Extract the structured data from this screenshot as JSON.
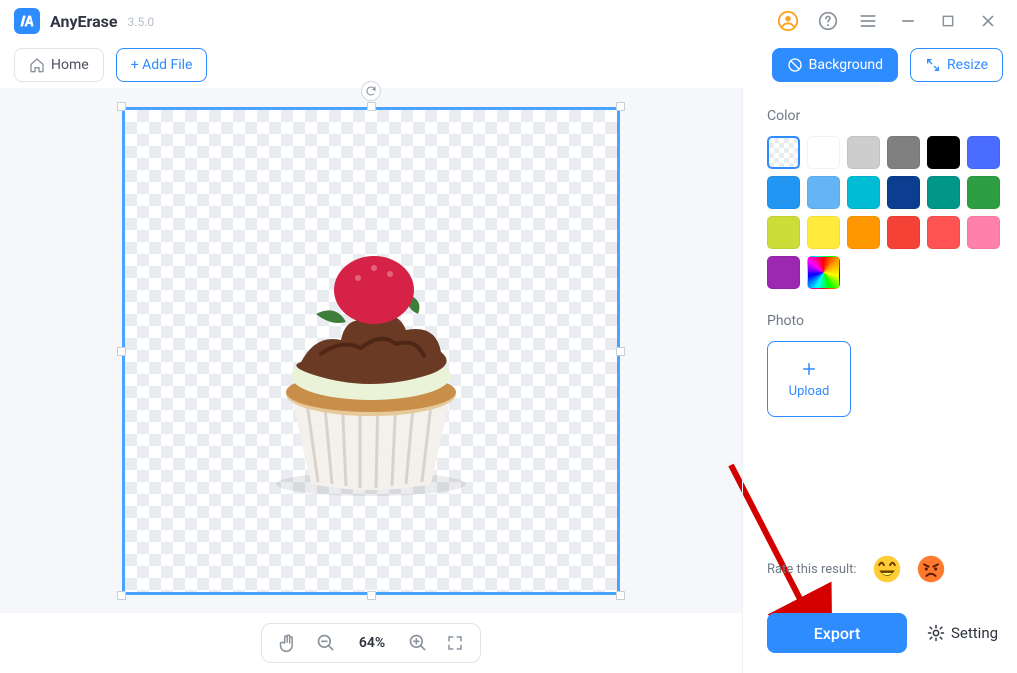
{
  "app": {
    "name": "AnyErase",
    "version": "3.5.0"
  },
  "toolbar": {
    "home": "Home",
    "add_file": "+ Add File",
    "background": "Background",
    "resize": "Resize"
  },
  "zoom": {
    "value": "64%"
  },
  "right_panel": {
    "color_title": "Color",
    "photo_title": "Photo",
    "upload_label": "Upload",
    "swatches": [
      "transparent",
      "#ffffff",
      "#cdcdcd",
      "#808080",
      "#000000",
      "#4a6cff",
      "#2196f3",
      "#64b5f6",
      "#00bcd4",
      "#0b3d91",
      "#009688",
      "#2e9e43",
      "#cddc39",
      "#ffeb3b",
      "#ff9800",
      "#f44336",
      "#ff5252",
      "#ff80ab",
      "#9c27b0",
      "rainbow"
    ]
  },
  "rate": {
    "label": "Rate this result:"
  },
  "actions": {
    "export": "Export",
    "setting": "Setting"
  }
}
